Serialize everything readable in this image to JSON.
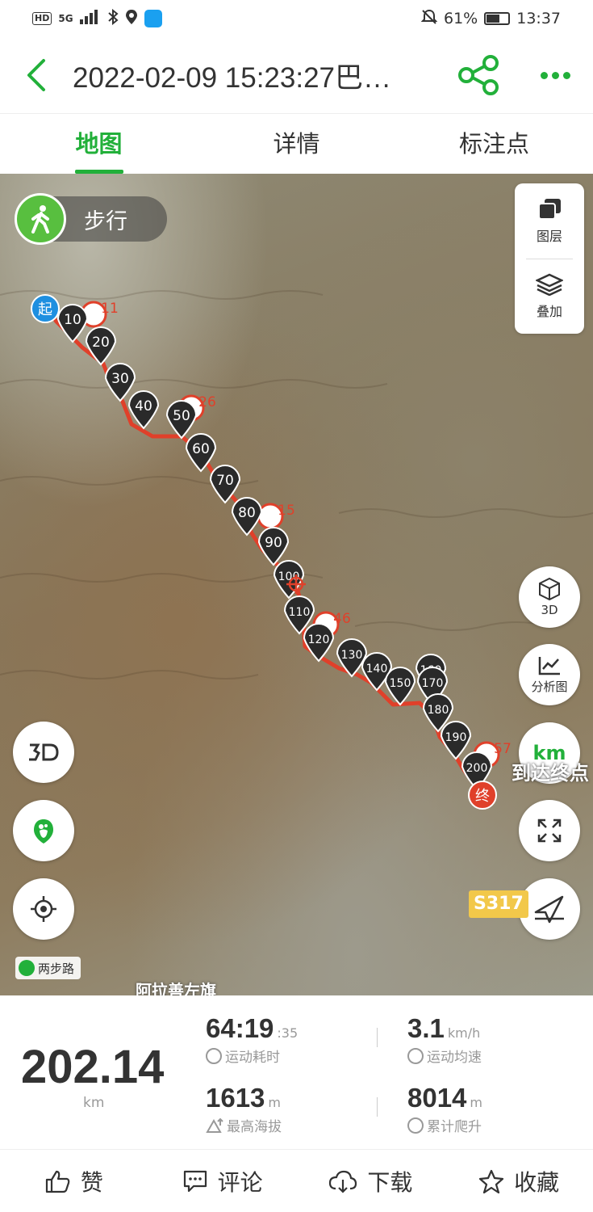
{
  "status_bar": {
    "left_badge": "HD",
    "signal_text": "5G",
    "battery_percent": "61%",
    "time": "13:37"
  },
  "header": {
    "title": "2022-02-09 15:23:27巴…",
    "accent_color": "#22b03a"
  },
  "tabs": [
    {
      "label": "地图",
      "active": true
    },
    {
      "label": "详情",
      "active": false
    },
    {
      "label": "标注点",
      "active": false
    }
  ],
  "map": {
    "mode_label": "步行",
    "layer_controls": [
      {
        "label": "图层",
        "icon": "layers-square-icon"
      },
      {
        "label": "叠加",
        "icon": "stack-icon"
      }
    ],
    "right_buttons": {
      "3d": "3D",
      "analysis": "分析图",
      "km": "km"
    },
    "start_marker": "起",
    "end_marker": "终",
    "km_markers": [
      "10",
      "20",
      "30",
      "40",
      "50",
      "60",
      "70",
      "80",
      "90",
      "100",
      "110",
      "120",
      "130",
      "140",
      "150",
      "160",
      "170",
      "180",
      "190",
      "200"
    ],
    "waypoint_counts": [
      "11",
      "26",
      "15",
      "46",
      "57"
    ],
    "road_badge": "S317",
    "map_logo": "两步路",
    "place_label": "阿拉善左旗",
    "end_label": "到达终点",
    "route_color": "#e0402a"
  },
  "stats": {
    "distance": "202.14",
    "distance_unit": "km",
    "duration": "64:19",
    "duration_seconds": ":35",
    "duration_label": "运动耗时",
    "avg_speed": "3.1",
    "avg_speed_unit": "km/h",
    "avg_speed_label": "运动均速",
    "max_altitude": "1613",
    "max_altitude_unit": "m",
    "max_altitude_label": "最高海拔",
    "total_climb": "8014",
    "total_climb_unit": "m",
    "total_climb_label": "累计爬升"
  },
  "actions": [
    {
      "label": "赞",
      "icon": "thumbs-up-icon"
    },
    {
      "label": "评论",
      "icon": "comment-icon"
    },
    {
      "label": "下载",
      "icon": "cloud-download-icon"
    },
    {
      "label": "收藏",
      "icon": "star-icon"
    }
  ]
}
